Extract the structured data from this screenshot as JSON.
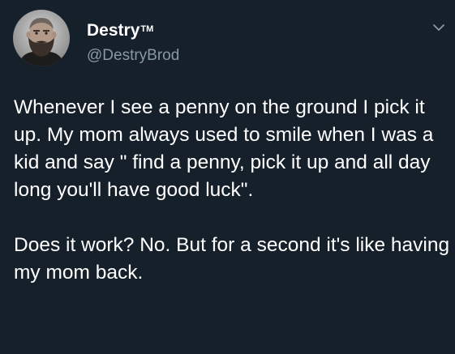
{
  "author": {
    "name": "Destry",
    "trademark": "TM",
    "handle": "@DestryBrod"
  },
  "icons": {
    "avatar": "bearded-man-photo-icon",
    "menu": "chevron-down-icon"
  },
  "tweet": {
    "paragraphs": [
      "Whenever I see a penny on the ground I pick it up. My mom always used to smile when I was a kid and say \" find a penny, pick it up and all day long you'll have good luck\".",
      "Does it work? No. But for a second it's like having my mom back."
    ]
  },
  "colors": {
    "background": "#15202b",
    "text": "#ffffff",
    "secondary_text": "#8899a6"
  }
}
